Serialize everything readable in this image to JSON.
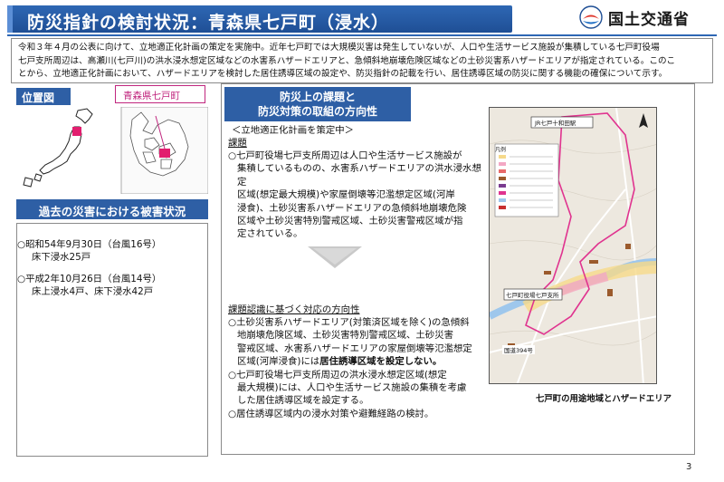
{
  "header": {
    "title": "防災指針の検討状況：青森県七戸町（浸水）",
    "ministry": "国土交通省"
  },
  "intro": {
    "lines": [
      "令和３年４月の公表に向けて、立地適正化計画の策定を実施中。近年七戸町では大規模災害は発生していないが、人口や生活サービス施設が集積している七戸町役場",
      "七戸支所周辺は、高瀬川(七戸川)の洪水浸水想定区域などの水害系ハザードエリアと、急傾斜地崩壊危険区域などの土砂災害系ハザードエリアが指定されている。このこ",
      "とから、立地適正化計画において、ハザードエリアを検討した居住誘導区域の設定や、防災指針の記載を行い、居住誘導区域の防災に関する機能の確保について示す。"
    ]
  },
  "location": {
    "label": "位置図",
    "callout": "青森県七戸町"
  },
  "past_disasters": {
    "heading": "過去の災害における被害状況",
    "items": [
      {
        "line1": "○昭和54年9月30日（台風16号）",
        "line2": "床下浸水25戸"
      },
      {
        "line1": "○平成2年10月26日（台風14号）",
        "line2": "床上浸水4戸、床下浸水42戸"
      }
    ]
  },
  "issues": {
    "heading_line1": "防災上の課題と",
    "heading_line2": "防災対策の取組の方向性",
    "sub_heading": "＜立地適正化計画を策定中＞",
    "issue_label": "課題",
    "issue_lines": [
      "○七戸町役場七戸支所周辺は人口や生活サービス施設が",
      "集積しているものの、水害系ハザードエリアの洪水浸水想定",
      "区域(想定最大規模)や家屋倒壊等氾濫想定区域(河岸",
      "浸食)、土砂災害系ハザードエリアの急傾斜地崩壊危険",
      "区域や土砂災害特別警戒区域、土砂災害警戒区域が指",
      "定されている。"
    ],
    "policy_label": "課題認識に基づく対応の方向性",
    "policy_lines": [
      "○土砂災害系ハザードエリア(対策済区域を除く)の急傾斜",
      "地崩壊危険区域、土砂災害特別警戒区域、土砂災害",
      "警戒区域、水害系ハザードエリアの家屋倒壊等氾濫想定"
    ],
    "policy_line4_normal": "区域(河岸浸食)には",
    "policy_line4_bold": "居住誘導区域を設定しない。",
    "policy_lines_b": [
      "○七戸町役場七戸支所周辺の洪水浸水想定区域(想定",
      "最大規模)には、人口や生活サービス施設の集積を考慮",
      "した居住誘導区域を設定する。",
      "○居住誘導区域内の浸水対策や避難経路の検討。"
    ]
  },
  "map": {
    "caption": "七戸町の用途地域とハザードエリア",
    "label_station": "JR七戸十和田駅",
    "label_office": "七戸町役場七戸支所",
    "label_road": "国道394号",
    "legend_title": "凡例"
  },
  "page_number": "3"
}
